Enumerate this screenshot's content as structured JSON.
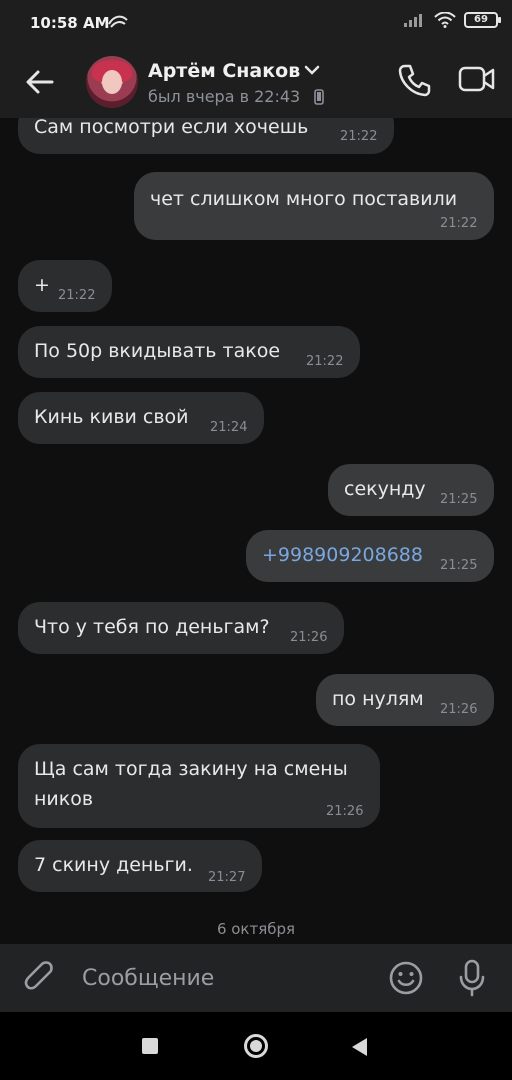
{
  "status_bar": {
    "time": "10:58 AM",
    "battery": "69"
  },
  "header": {
    "contact_name": "Артём Снаков",
    "last_seen": "был вчера в 22:43"
  },
  "messages": [
    {
      "dir": "in",
      "text": "Сам посмотри если хочешь",
      "time": "21:22"
    },
    {
      "dir": "out",
      "text": "чет слишком много поставили",
      "time": "21:22"
    },
    {
      "dir": "in",
      "text": "+",
      "time": "21:22"
    },
    {
      "dir": "in",
      "text": "По 50р вкидывать такое",
      "time": "21:22"
    },
    {
      "dir": "in",
      "text": "Кинь киви свой",
      "time": "21:24"
    },
    {
      "dir": "out",
      "text": "секунду",
      "time": "21:25"
    },
    {
      "dir": "out",
      "text": "+998909208688",
      "time": "21:25"
    },
    {
      "dir": "in",
      "text": "Что у тебя по деньгам?",
      "time": "21:26"
    },
    {
      "dir": "out",
      "text": "по нулям",
      "time": "21:26"
    },
    {
      "dir": "in",
      "text": "Ща сам тогда закину на смены",
      "text2": "ников",
      "time": "21:26"
    },
    {
      "dir": "in",
      "text": "7 скину деньги.",
      "time": "21:27"
    }
  ],
  "date_separator": "6 октября",
  "composer": {
    "placeholder": "Сообщение"
  },
  "colors": {
    "background": "#0f0f10",
    "bubble_in": "#2c2d2e",
    "bubble_out": "#3a3b3c",
    "link": "#7aa7e0"
  }
}
